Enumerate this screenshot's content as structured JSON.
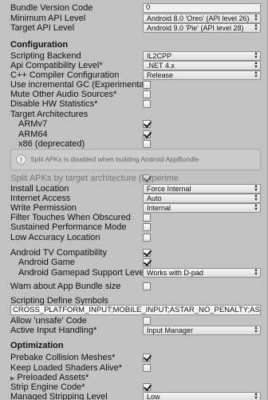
{
  "top": {
    "bundle_version_code": {
      "label": "Bundle Version Code",
      "value": "0"
    },
    "min_api": {
      "label": "Minimum API Level",
      "value": "Android 8.0 'Oreo' (API level 26)"
    },
    "target_api": {
      "label": "Target API Level",
      "value": "Android 9.0 'Pie' (API level 28)"
    }
  },
  "configuration": {
    "header": "Configuration",
    "scripting_backend": {
      "label": "Scripting Backend",
      "value": "IL2CPP"
    },
    "api_compat": {
      "label": "Api Compatibility Level*",
      "value": ".NET 4.x"
    },
    "cpp_compiler": {
      "label": "C++ Compiler Configuration",
      "value": "Release"
    },
    "incremental_gc": {
      "label": "Use incremental GC (Experimental)",
      "checked": false
    },
    "mute_audio": {
      "label": "Mute Other Audio Sources*",
      "checked": false
    },
    "disable_hw_stats": {
      "label": "Disable HW Statistics*",
      "checked": false
    },
    "target_arch": {
      "label": "Target Architectures"
    },
    "armv7": {
      "label": "ARMv7",
      "checked": true
    },
    "arm64": {
      "label": "ARM64",
      "checked": true
    },
    "x86": {
      "label": "x86 (deprecated)",
      "checked": false
    },
    "help_text": "Split APKs is disabled when building Android AppBundle",
    "split_apks": {
      "label": "Split APKs by target architecture (Experime",
      "checked": true
    },
    "install_location": {
      "label": "Install Location",
      "value": "Force Internal"
    },
    "internet_access": {
      "label": "Internet Access",
      "value": "Auto"
    },
    "write_permission": {
      "label": "Write Permission",
      "value": "Internal"
    },
    "filter_touches": {
      "label": "Filter Touches When Obscured",
      "checked": false
    },
    "sustained_perf": {
      "label": "Sustained Performance Mode",
      "checked": false
    },
    "low_accuracy": {
      "label": "Low Accuracy Location",
      "checked": false
    },
    "android_tv": {
      "label": "Android TV Compatibility",
      "checked": true
    },
    "android_game": {
      "label": "Android Game",
      "checked": true
    },
    "gamepad_support": {
      "label": "Android Gamepad Support Level",
      "value": "Works with D-pad"
    },
    "warn_bundle": {
      "label": "Warn about App Bundle size",
      "checked": false
    },
    "define_symbols": {
      "label": "Scripting Define Symbols",
      "value": "CROSS_PLATFORM_INPUT;MOBILE_INPUT;ASTAR_NO_PENALTY;ASTAR_NoGUI"
    },
    "allow_unsafe": {
      "label": "Allow 'unsafe' Code",
      "checked": false
    },
    "active_input": {
      "label": "Active Input Handling*",
      "value": "Input Manager"
    }
  },
  "optimization": {
    "header": "Optimization",
    "prebake": {
      "label": "Prebake Collision Meshes*",
      "checked": true
    },
    "keep_shaders": {
      "label": "Keep Loaded Shaders Alive*",
      "checked": false
    },
    "preloaded_assets": {
      "label": "Preloaded Assets*"
    },
    "strip_engine": {
      "label": "Strip Engine Code*",
      "checked": true
    },
    "managed_stripping": {
      "label": "Managed Stripping Level",
      "value": "Low"
    }
  }
}
